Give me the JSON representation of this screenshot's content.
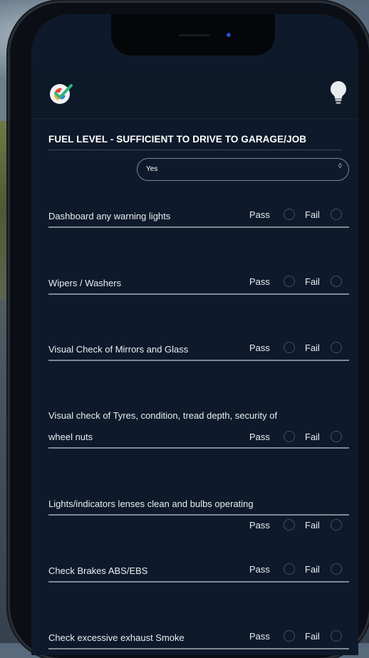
{
  "app": {
    "logo_icon": "checkmark-palette-logo",
    "bulb_icon": "lightbulb-icon"
  },
  "section": {
    "title": "FUEL LEVEL - SUFFICIENT TO DRIVE TO GARAGE/JOB",
    "select_value": "Yes",
    "select_caret": "◊"
  },
  "pass_label": "Pass",
  "fail_label": "Fail",
  "items": [
    {
      "label": "Dashboard any warning lights"
    },
    {
      "label": "Wipers / Washers"
    },
    {
      "label": "Visual Check of Mirrors and Glass"
    },
    {
      "label_line1": "Visual check of Tyres, condition, tread depth, security of",
      "label_line2": "wheel nuts"
    },
    {
      "label": "Lights/indicators lenses clean and bulbs operating"
    },
    {
      "label": "Check Brakes ABS/EBS"
    },
    {
      "label": "Check excessive exhaust Smoke"
    }
  ],
  "colors": {
    "screen_bg": "#0e1a2b",
    "text": "#e8edf3",
    "rule": "#7f8894"
  }
}
